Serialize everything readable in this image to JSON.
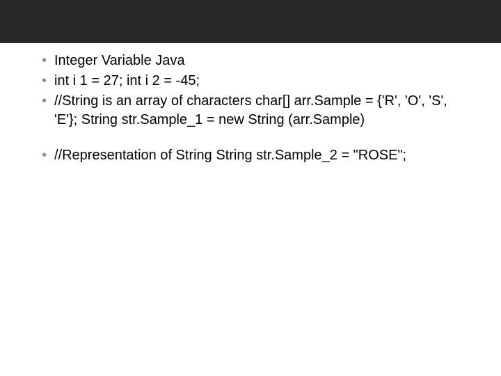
{
  "slide": {
    "bullets": [
      "Integer Variable Java",
      "int i 1 = 27; int i 2 = -45;",
      "//String is an array of characters char[] arr.Sample = {'R', 'O', 'S', 'E'}; String str.Sample_1 = new String (arr.Sample)",
      "//Representation of String String str.Sample_2 = \"ROSE\";"
    ]
  }
}
